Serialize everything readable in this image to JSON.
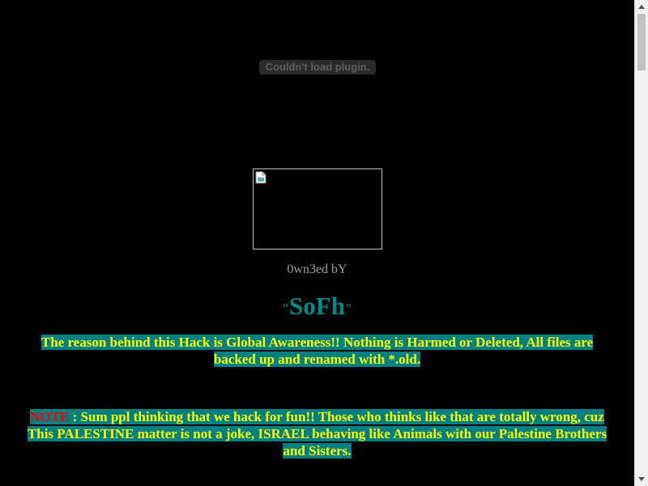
{
  "plugin_error": "Couldn't load plugin.",
  "owned_by": "0wn3ed bY",
  "signature": {
    "open_quote": "\"",
    "name": "SoFh",
    "close_quote": "\""
  },
  "message1": {
    "line1": "The reason behind this Hack is Global Awareness!! Nothing is Harmed or Deleted, All files are",
    "line2": "backed up and renamed with *.old."
  },
  "message2": {
    "note_label": "NOTE",
    "line1": " : Sum ppl thinking that we hack for fun!! Those who thinks like that are totally wrong, cuz",
    "line2": "This PALESTINE matter is not a joke, ISRAEL behaving like Animals with our Palestine Brothers",
    "line3": "and Sisters."
  },
  "icons": {
    "broken_image": "broken-image-icon",
    "scroll_up": "scroll-up-arrow-icon",
    "scroll_down": "scroll-down-arrow-icon"
  },
  "colors": {
    "background": "#000000",
    "highlight_bg": "#008080",
    "highlight_text": "#ffff00",
    "note_text": "#ff0000",
    "signature": "#008b8b",
    "owned_by": "#a0a0a0"
  }
}
